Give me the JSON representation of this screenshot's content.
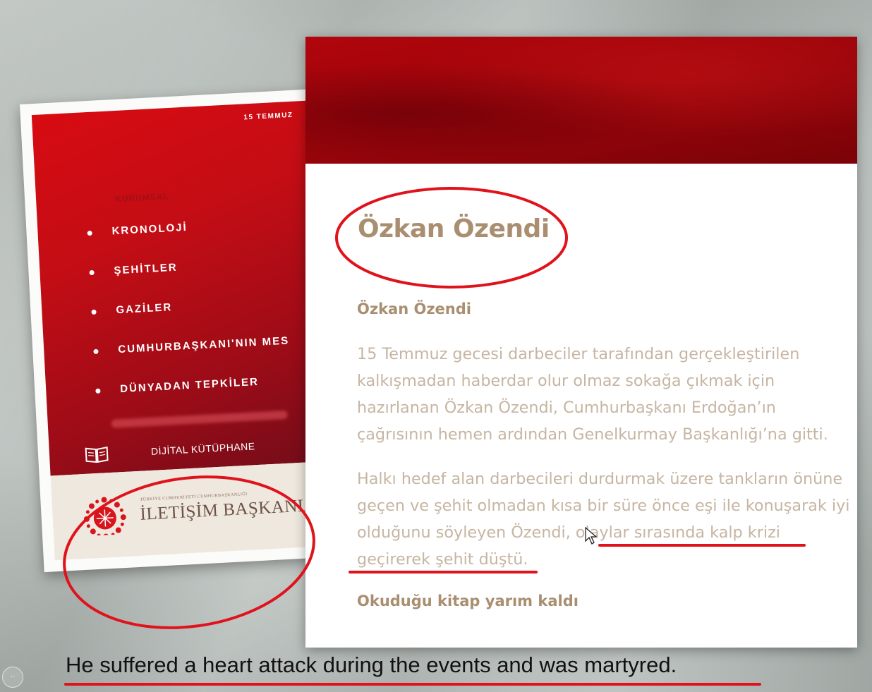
{
  "left_card": {
    "date": "15 TEMMUZ",
    "kurumsal": "KURUMSAL",
    "menu": [
      "KRONOLOJİ",
      "ŞEHİTLER",
      "GAZİLER",
      "CUMHURBAŞKANI'NIN MES",
      "DÜNYADAN TEPKİLER"
    ],
    "library_label": "DİJİTAL KÜTÜPHANE",
    "logo_small": "TÜRKİYE CUMHURİYETİ CUMHURBAŞKANLIĞI",
    "logo_big": "İLETİŞİM BAŞKANLIĞI"
  },
  "article": {
    "title": "Özkan Özendi",
    "subtitle": "Özkan Özendi",
    "paragraph1": "15 Temmuz gecesi darbeciler tarafından gerçekleştirilen kalkışmadan haberdar olur olmaz sokağa çıkmak için hazırlanan Özkan Özendi, Cumhurbaşkanı Erdoğan’ın çağrısının hemen ardından Genelkurmay Başkanlığı’na gitti.",
    "paragraph2": "Halkı hedef alan darbecileri durdurmak üzere tankların önüne geçen ve şehit olmadan kısa bir süre önce eşi ile konuşarak iyi olduğunu söyleyen Özendi, olaylar sırasında kalp krizi geçirerek şehit düştü.",
    "heading2": "Okuduğu kitap yarım kaldı"
  },
  "caption": "He suffered a heart attack during the events and was martyred.",
  "colors": {
    "brand_red": "#c30d15",
    "text_gold": "#a98e70",
    "annotation_red": "#e0121b"
  }
}
